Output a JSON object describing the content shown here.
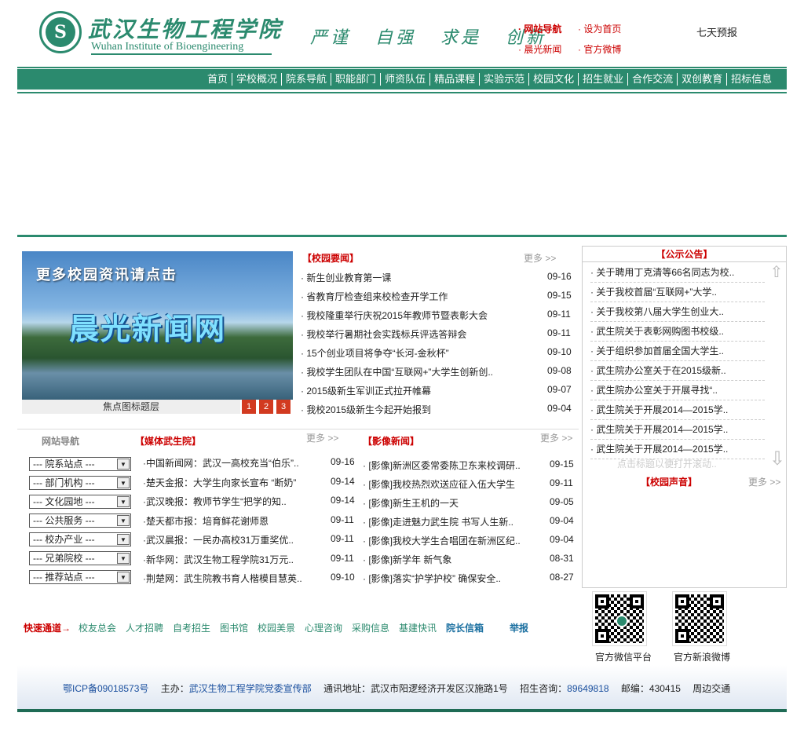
{
  "header": {
    "logo_letter": "S",
    "logo_cn": "武汉生物工程学院",
    "logo_en": "Wuhan Institute of Bioengineering",
    "motto": "严谨 自强 求是 创新",
    "links": {
      "site_nav": "· 网站导航",
      "set_home": "· 设为首页",
      "morning_news": "· 晨光新闻",
      "weibo": "· 官方微博"
    },
    "weather": "七天预报"
  },
  "nav": {
    "items": [
      "首页",
      "学校概况",
      "院系导航",
      "职能部门",
      "师资队伍",
      "精品课程",
      "实验示范",
      "校园文化",
      "招生就业",
      "合作交流",
      "双创教育",
      "招标信息"
    ]
  },
  "focus": {
    "overlay_text": "更多校园资讯请点击",
    "big_text": "晨光新闻网",
    "caption": "焦点图标题层",
    "slides": [
      "1",
      "2",
      "3"
    ]
  },
  "campus_news": {
    "title": "【校园要闻】",
    "more": "更多 >>",
    "items": [
      {
        "title": "· 新生创业教育第一课",
        "date": "09-16"
      },
      {
        "title": "· 省教育厅检查组来校检查开学工作",
        "date": "09-15"
      },
      {
        "title": "· 我校隆重举行庆祝2015年教师节暨表彰大会",
        "date": "09-11"
      },
      {
        "title": "· 我校举行暑期社会实践标兵评选答辩会",
        "date": "09-11"
      },
      {
        "title": "· 15个创业项目将争夺“长河-金秋杯”",
        "date": "09-10"
      },
      {
        "title": "· 我校学生团队在中国“互联网+”大学生创新创..",
        "date": "09-08"
      },
      {
        "title": "· 2015级新生军训正式拉开帷幕",
        "date": "09-07"
      },
      {
        "title": "· 我校2015级新生今起开始报到",
        "date": "09-04"
      }
    ]
  },
  "notice": {
    "title": "【公示公告】",
    "items": [
      "· 关于聘用丁克清等66名同志为校..",
      "· 关于我校首届“互联网+”大学..",
      "· 关于我校第八届大学生创业大..",
      "· 武生院关于表彰网购图书校级..",
      "· 关于组织参加首届全国大学生..",
      "· 武生院办公室关于在2015级新..",
      "· 武生院办公室关于开展寻找“..",
      "· 武生院关于开展2014—2015学..",
      "· 武生院关于开展2014—2015学..",
      "· 武生院关于开展2014—2015学.."
    ],
    "hint": "点击标题以便打开滚动..",
    "up_arrow": "⇧",
    "down_arrow": "⇩"
  },
  "campus_voice": {
    "title": "【校园声音】",
    "more": "更多 >>"
  },
  "site_nav": {
    "title": "网站导航",
    "selects": [
      "--- 院系站点 ---",
      "--- 部门机构 ---",
      "--- 文化园地 ---",
      "--- 公共服务 ---",
      "--- 校办产业 ---",
      "--- 兄弟院校 ---",
      "--- 推荐站点 ---"
    ]
  },
  "media": {
    "title": "【媒体武生院】",
    "more": "更多 >>",
    "items": [
      {
        "title": "·中国新闻网：武汉一高校充当“伯乐”..",
        "date": "09-16"
      },
      {
        "title": "·楚天金报：大学生向家长宣布 “断奶”",
        "date": "09-14"
      },
      {
        "title": "·武汉晚报：教师节学生“把学的知..",
        "date": "09-14"
      },
      {
        "title": "·楚天都市报：培育鲜花谢师恩",
        "date": "09-11"
      },
      {
        "title": "·武汉晨报：一民办高校31万重奖优..",
        "date": "09-11"
      },
      {
        "title": "·新华网：武汉生物工程学院31万元..",
        "date": "09-11"
      },
      {
        "title": "·荆楚网：武生院教书育人楷模目慧英..",
        "date": "09-10"
      }
    ]
  },
  "image_news": {
    "title": "【影像新闻】",
    "more": "更多 >>",
    "items": [
      {
        "title": "· [影像]新洲区委常委陈卫东来校调研..",
        "date": "09-15"
      },
      {
        "title": "· [影像]我校热烈欢送应征入伍大学生",
        "date": "09-11"
      },
      {
        "title": "· [影像]新生王机的一天",
        "date": "09-05"
      },
      {
        "title": "· [影像]走进魅力武生院 书写人生新..",
        "date": "09-04"
      },
      {
        "title": "· [影像]我校大学生合唱团在新洲区纪..",
        "date": "09-04"
      },
      {
        "title": "· [影像]新学年 新气象",
        "date": "08-31"
      },
      {
        "title": "· [影像]落实“护学护校” 确保安全..",
        "date": "08-27"
      }
    ]
  },
  "quick": {
    "label": "快速通道→",
    "links": [
      "校友总会",
      "人才招聘",
      "自考招生",
      "图书馆",
      "校园美景",
      "心理咨询",
      "采购信息",
      "基建快讯",
      "院长信箱",
      "举报"
    ]
  },
  "qr": {
    "wechat_label": "官方微信平台",
    "weibo_label": "官方新浪微博"
  },
  "footer": {
    "icp": "鄂ICP备09018573号",
    "host_label": "主办：",
    "host": "武汉生物工程学院党委宣传部",
    "address": "通讯地址：武汉市阳逻经济开发区汉施路1号",
    "phone_label": "招生咨询：",
    "phone": "89649818",
    "postcode": "邮编：430415",
    "traffic": "周边交通"
  },
  "colors": {
    "brand_green": "#2b8a6e",
    "accent_red": "#c00",
    "footer_blue": "#1a4f9e"
  }
}
